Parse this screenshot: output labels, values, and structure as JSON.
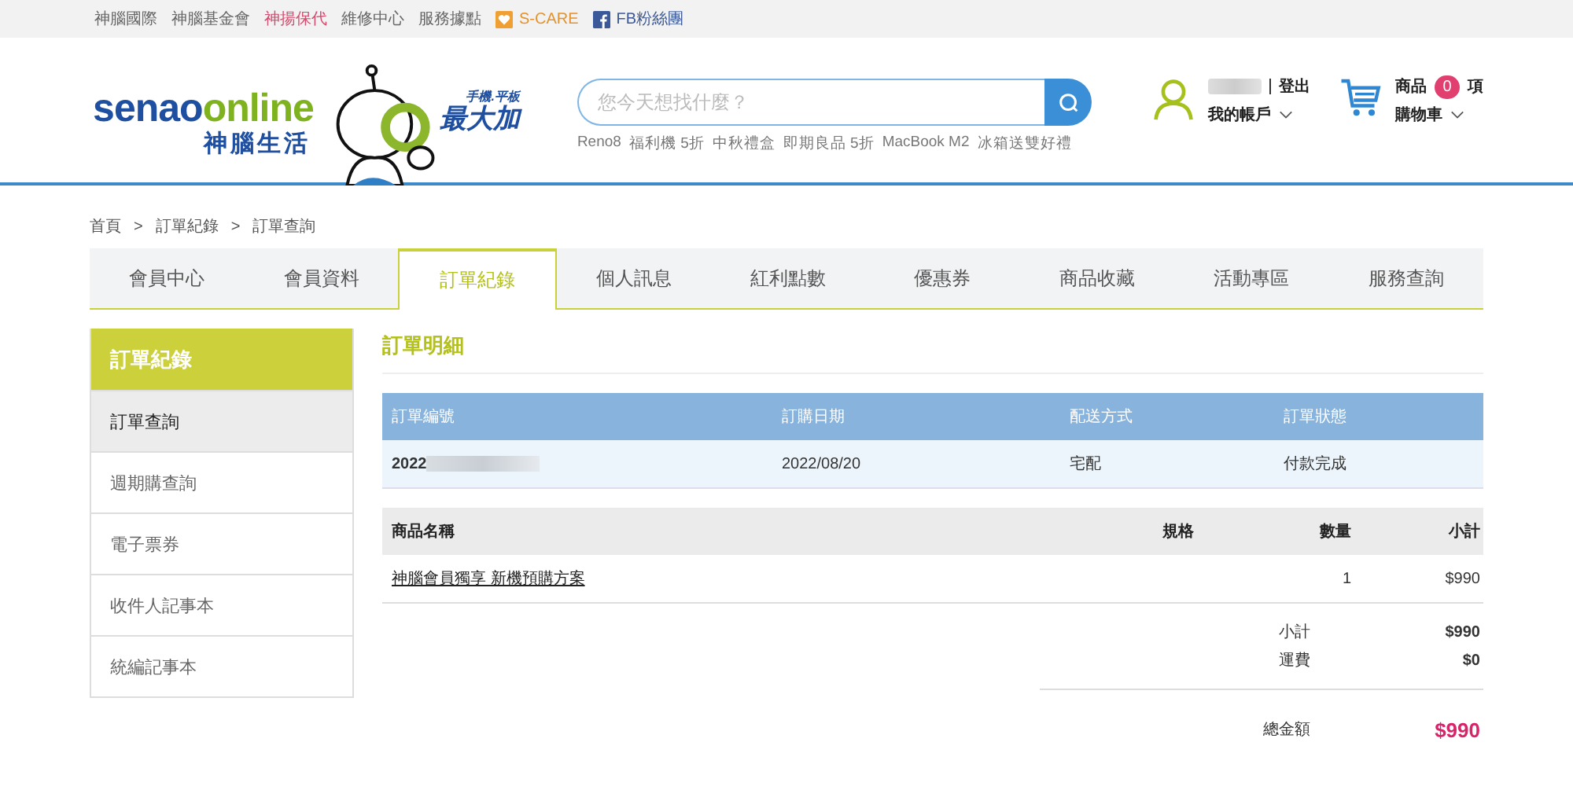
{
  "topbar": {
    "links": [
      {
        "label": "神腦國際",
        "kind": "plain"
      },
      {
        "label": "神腦基金會",
        "kind": "plain"
      },
      {
        "label": "神揚保代",
        "kind": "highlight"
      },
      {
        "label": "維修中心",
        "kind": "plain"
      },
      {
        "label": "服務據點",
        "kind": "plain"
      },
      {
        "label": "S-CARE",
        "kind": "scare"
      },
      {
        "label": "FB粉絲團",
        "kind": "facebook"
      }
    ]
  },
  "header": {
    "logo": {
      "brand_a": "senao",
      "brand_b": "online",
      "subtitle": "神腦生活"
    },
    "promo": {
      "tagline": "手機.平板",
      "title": "最大加"
    },
    "search": {
      "placeholder": "您今天想找什麼？",
      "suggestions": [
        "Reno8",
        "福利機 5折",
        "中秋禮盒",
        "即期良品 5折",
        "MacBook M2",
        "冰箱送雙好禮"
      ]
    },
    "account": {
      "logout": "登出",
      "label": "我的帳戶"
    },
    "cart": {
      "label": "商品",
      "count": "0",
      "unit": "項",
      "sublabel": "購物車"
    }
  },
  "breadcrumb": {
    "separator": ">",
    "items": [
      "首頁",
      "訂單紀錄",
      "訂單查詢"
    ]
  },
  "tabs": [
    {
      "label": "會員中心",
      "selected": false
    },
    {
      "label": "會員資料",
      "selected": false
    },
    {
      "label": "訂單紀錄",
      "selected": true
    },
    {
      "label": "個人訊息",
      "selected": false
    },
    {
      "label": "紅利點數",
      "selected": false
    },
    {
      "label": "優惠券",
      "selected": false
    },
    {
      "label": "商品收藏",
      "selected": false
    },
    {
      "label": "活動專區",
      "selected": false
    },
    {
      "label": "服務查詢",
      "selected": false
    }
  ],
  "sidebar": {
    "title": "訂單紀錄",
    "items": [
      {
        "label": "訂單查詢",
        "selected": true
      },
      {
        "label": "週期購查詢",
        "selected": false
      },
      {
        "label": "電子票券",
        "selected": false
      },
      {
        "label": "收件人記事本",
        "selected": false
      },
      {
        "label": "統編記事本",
        "selected": false
      }
    ]
  },
  "order": {
    "title": "訂單明細",
    "columns": [
      "訂單編號",
      "訂購日期",
      "配送方式",
      "訂單狀態"
    ],
    "row": {
      "number": "2022",
      "date": "2022/08/20",
      "shipping": "宅配",
      "status": "付款完成"
    }
  },
  "items": {
    "columns": [
      "商品名稱",
      "規格",
      "數量",
      "小計"
    ],
    "rows": [
      {
        "name": "神腦會員獨享 新機預購方案",
        "qty": "1",
        "subtotal": "$990"
      }
    ]
  },
  "summary": [
    {
      "label": "小計",
      "value": "$990"
    },
    {
      "label": "運費",
      "value": "$0"
    }
  ],
  "total": {
    "label": "總金額",
    "value": "$990"
  }
}
